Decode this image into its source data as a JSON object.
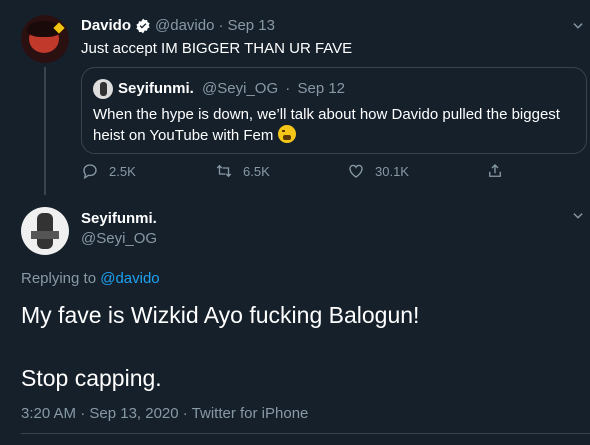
{
  "parent_tweet": {
    "name": "Davido",
    "handle": "@davido",
    "separator": "·",
    "date": "Sep 13",
    "text": "Just accept IM BIGGER THAN  UR FAVE",
    "quote": {
      "name": "Seyifunmi.",
      "handle": "@Seyi_OG",
      "separator": "·",
      "date": "Sep 12",
      "text": "When the hype is down, we’ll talk about how Davido pulled the biggest heist on YouTube with Fem"
    },
    "actions": {
      "replies": "2.5K",
      "retweets": "6.5K",
      "likes": "30.1K"
    }
  },
  "focal_tweet": {
    "name": "Seyifunmi.",
    "handle": "@Seyi_OG",
    "replying_prefix": "Replying to",
    "replying_to": "@davido",
    "text_line1": "My fave is Wizkid Ayo fucking Balogun!",
    "text_line2": "Stop capping.",
    "meta": "3:20 AM · Sep 13, 2020 · Twitter for iPhone"
  },
  "colors": {
    "background": "#15202b",
    "muted": "#8899a6",
    "link": "#1da1f2",
    "border": "#38444d"
  }
}
